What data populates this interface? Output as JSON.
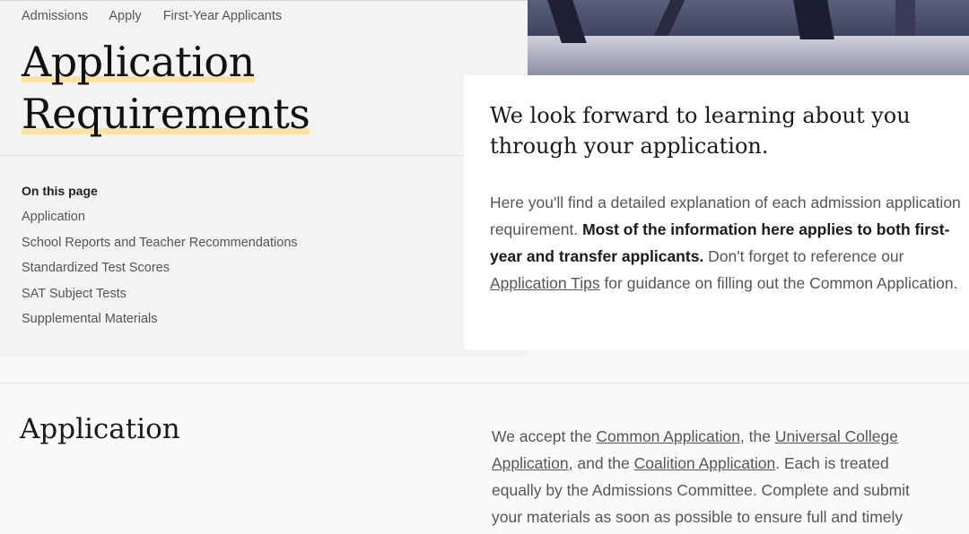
{
  "breadcrumb": [
    "Admissions",
    "Apply",
    "First-Year Applicants"
  ],
  "page_title": {
    "line1": "Application",
    "line2": "Requirements"
  },
  "toc": {
    "heading": "On this page",
    "items": [
      "Application",
      "School Reports and Teacher Recommendations",
      "Standardized Test Scores",
      "SAT Subject Tests",
      "Supplemental Materials"
    ]
  },
  "intro": {
    "heading": "We look forward to learning about you through your application.",
    "text1": "Here you'll find a detailed explanation of each admission application requirement. ",
    "bold": "Most of the information here applies to both first-year and transfer applicants.",
    "text2": " Don't forget to reference our ",
    "link": "Application Tips",
    "text3": " for guidance on filling out the Common Application."
  },
  "application_section": {
    "title": "Application",
    "text1": "We accept the ",
    "link1": "Common Application",
    "text2": ", the ",
    "link2": "Universal College Application",
    "text3": ", and the ",
    "link3": "Coalition Application",
    "text4": ". Each is treated equally by the Admissions Committee. Complete and submit your materials as soon as possible to ensure full and timely"
  },
  "colors": {
    "highlight": "#fbe4a3",
    "panel": "#f4f3f1",
    "card": "#ffffff"
  }
}
